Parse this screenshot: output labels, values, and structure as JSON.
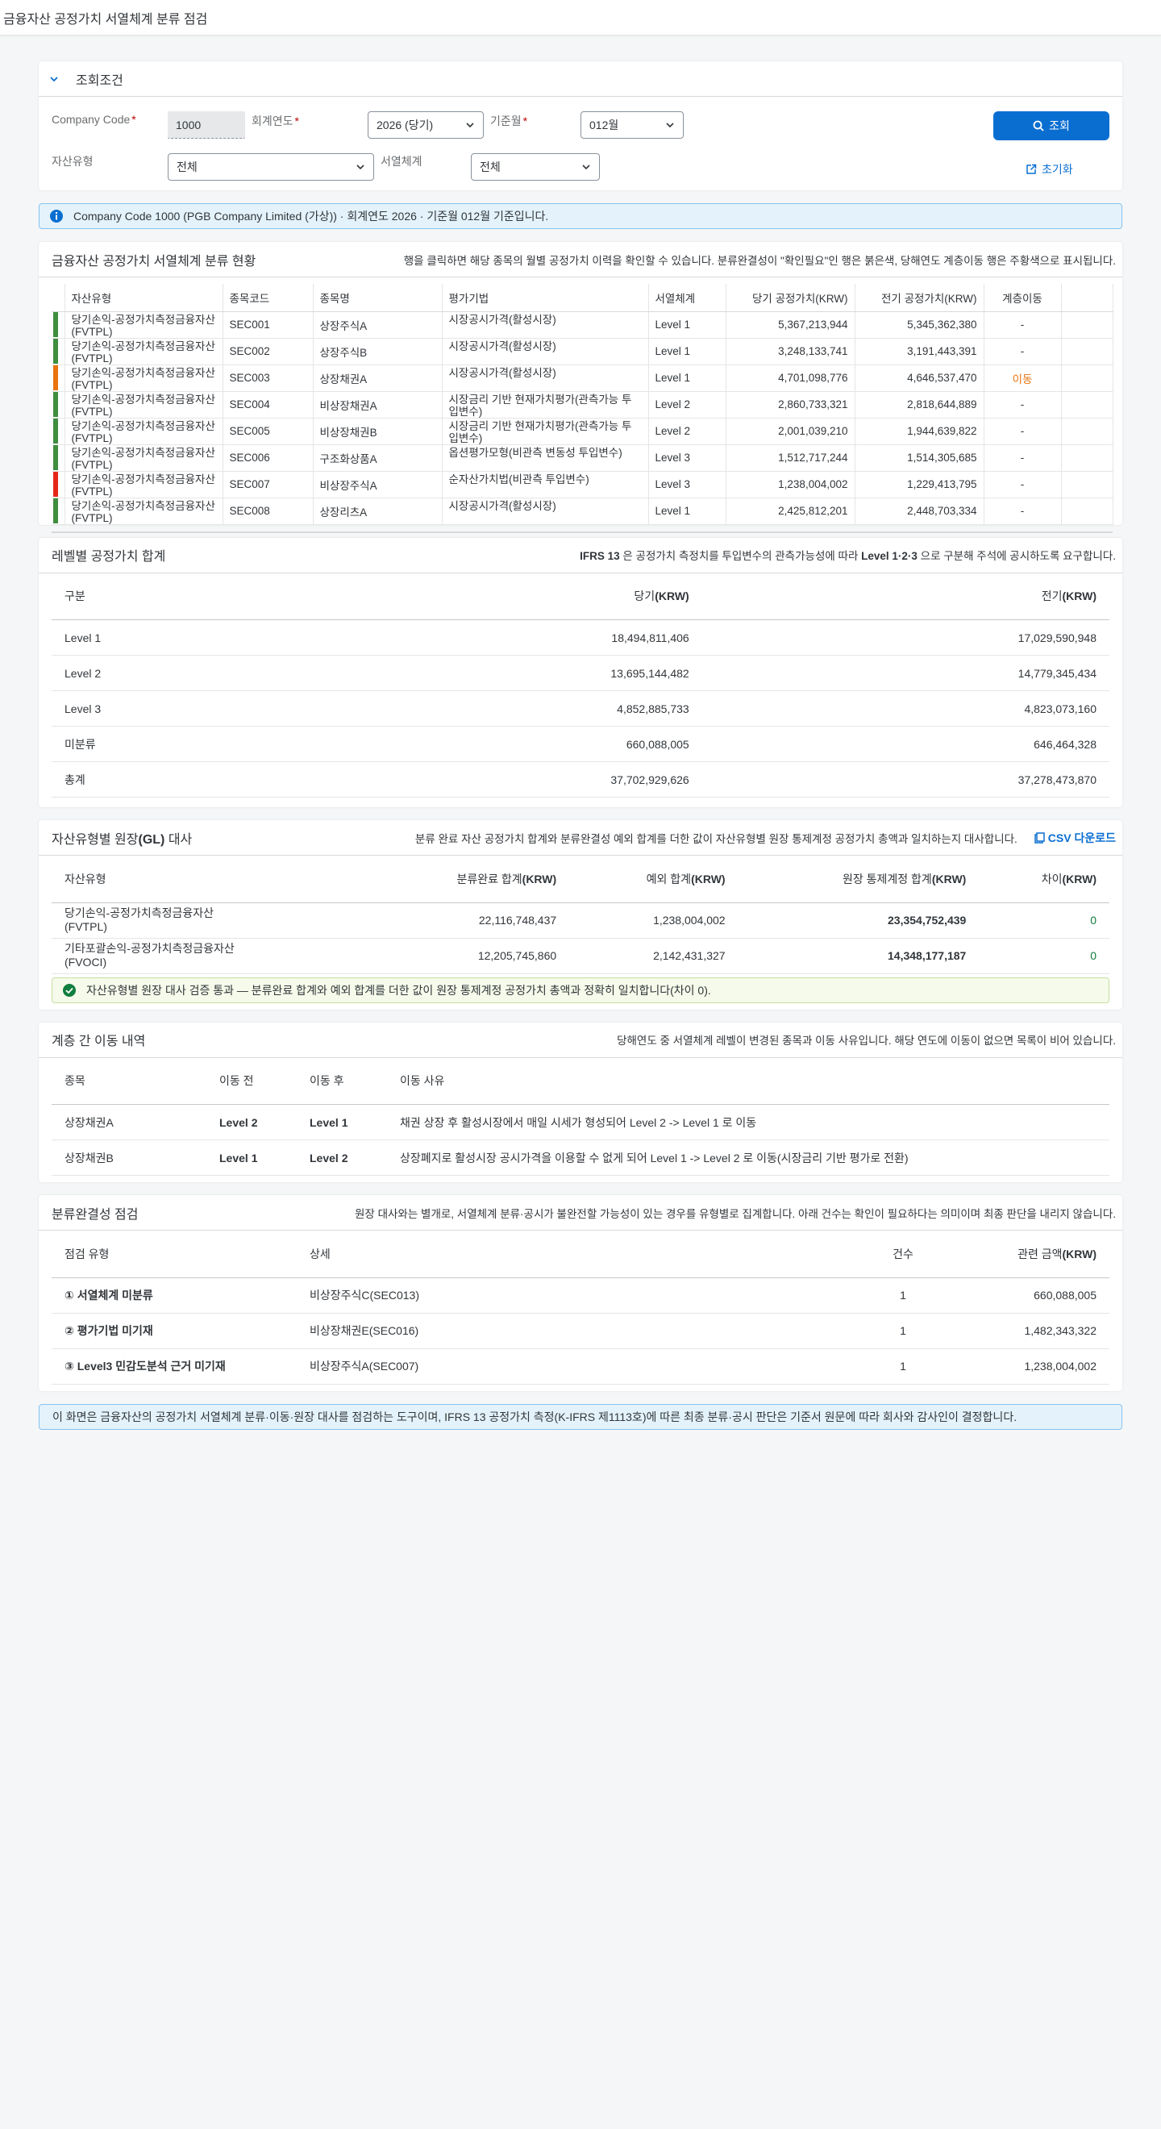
{
  "app": {
    "title": "금융자산 공정가치 서열체계 분류 점검"
  },
  "filter": {
    "title": "조회조건",
    "company_code_label": "Company Code",
    "company_code_value": "1000",
    "fiscal_year_label": "회계연도",
    "fiscal_year_value": "2026 (당기)",
    "period_label": "기준월",
    "period_value": "012월",
    "asset_type_label": "자산유형",
    "asset_type_value": "전체",
    "hierarchy_label": "서열체계",
    "hierarchy_value": "전체",
    "search_button": "조회",
    "reset_button": "초기화"
  },
  "info": {
    "text": "Company Code 1000 (PGB Company Limited (가상)) · 회계연도 2026 · 기준월 012월 기준입니다."
  },
  "classification": {
    "title": "금융자산 공정가치 서열체계 분류 현황",
    "desc": "행을 클릭하면 해당 종목의 월별 공정가치 이력을 확인할 수 있습니다. 분류완결성이 \"확인필요\"인 행은 붉은색, 당해연도 계층이동 행은 주황색으로 표시됩니다.",
    "columns": [
      "자산유형",
      "종목코드",
      "종목명",
      "평가기법",
      "서열체계",
      "당기 공정가치(KRW)",
      "전기 공정가치(KRW)",
      "계층이동"
    ],
    "rows": [
      {
        "status": "green",
        "asset_type": "당기손익-공정가치측정금융자산(FVTPL)",
        "code": "SEC001",
        "name": "상장주식A",
        "method": "시장공시가격(활성시장)",
        "level": "Level 1",
        "current": "5,367,213,944",
        "prior": "5,345,362,380",
        "move": "-"
      },
      {
        "status": "green",
        "asset_type": "당기손익-공정가치측정금융자산(FVTPL)",
        "code": "SEC002",
        "name": "상장주식B",
        "method": "시장공시가격(활성시장)",
        "level": "Level 1",
        "current": "3,248,133,741",
        "prior": "3,191,443,391",
        "move": "-"
      },
      {
        "status": "orange",
        "asset_type": "당기손익-공정가치측정금융자산(FVTPL)",
        "code": "SEC003",
        "name": "상장채권A",
        "method": "시장공시가격(활성시장)",
        "level": "Level 1",
        "current": "4,701,098,776",
        "prior": "4,646,537,470",
        "move": "이동"
      },
      {
        "status": "green",
        "asset_type": "당기손익-공정가치측정금융자산(FVTPL)",
        "code": "SEC004",
        "name": "비상장채권A",
        "method": "시장금리 기반 현재가치평가(관측가능 투입변수)",
        "level": "Level 2",
        "current": "2,860,733,321",
        "prior": "2,818,644,889",
        "move": "-"
      },
      {
        "status": "green",
        "asset_type": "당기손익-공정가치측정금융자산(FVTPL)",
        "code": "SEC005",
        "name": "비상장채권B",
        "method": "시장금리 기반 현재가치평가(관측가능 투입변수)",
        "level": "Level 2",
        "current": "2,001,039,210",
        "prior": "1,944,639,822",
        "move": "-"
      },
      {
        "status": "green",
        "asset_type": "당기손익-공정가치측정금융자산(FVTPL)",
        "code": "SEC006",
        "name": "구조화상품A",
        "method": "옵션평가모형(비관측 변동성 투입변수)",
        "level": "Level 3",
        "current": "1,512,717,244",
        "prior": "1,514,305,685",
        "move": "-"
      },
      {
        "status": "red",
        "asset_type": "당기손익-공정가치측정금융자산(FVTPL)",
        "code": "SEC007",
        "name": "비상장주식A",
        "method": "순자산가치법(비관측 투입변수)",
        "level": "Level 3",
        "current": "1,238,004,002",
        "prior": "1,229,413,795",
        "move": "-"
      },
      {
        "status": "green",
        "asset_type": "당기손익-공정가치측정금융자산(FVTPL)",
        "code": "SEC008",
        "name": "상장리츠A",
        "method": "시장공시가격(활성시장)",
        "level": "Level 1",
        "current": "2,425,812,201",
        "prior": "2,448,703,334",
        "move": "-"
      }
    ]
  },
  "level_totals": {
    "title": "레벨별 공정가치 합계",
    "desc_pre": "",
    "desc_bold1": "IFRS 13",
    "desc_mid": " 은 공정가치 측정치를 투입변수의 관측가능성에 따라 ",
    "desc_bold2": "Level 1·2·3",
    "desc_post": " 으로 구분해 주석에 공시하도록 요구합니다.",
    "col_category": "구분",
    "col_current_pre": "당기",
    "col_current_unit": "(KRW)",
    "col_prior_pre": "전기",
    "col_prior_unit": "(KRW)",
    "rows": [
      {
        "label": "Level 1",
        "current": "18,494,811,406",
        "prior": "17,029,590,948"
      },
      {
        "label": "Level 2",
        "current": "13,695,144,482",
        "prior": "14,779,345,434"
      },
      {
        "label": "Level 3",
        "current": "4,852,885,733",
        "prior": "4,823,073,160"
      },
      {
        "label": "미분류",
        "current": "660,088,005",
        "prior": "646,464,328"
      },
      {
        "label": "총계",
        "current": "37,702,929,626",
        "prior": "37,278,473,870"
      }
    ]
  },
  "gl": {
    "title_pre": "자산유형별 원장",
    "title_bold": "(GL)",
    "title_post": " 대사",
    "desc": "분류 완료 자산 공정가치 합계와 분류완결성 예외 합계를 더한 값이 자산유형별 원장 통제계정 공정가치 총액과 일치하는지 대사합니다.",
    "csv_label": "CSV 다운로드",
    "col_type": "자산유형",
    "col_classified_pre": "분류완료 합계",
    "col_exception_pre": "예외 합계",
    "col_ledger_pre": "원장 통제계정 합계",
    "col_diff_pre": "차이",
    "unit": "(KRW)",
    "rows": [
      {
        "type_l1": "당기손익-공정가치측정금융자산",
        "type_l2": "(FVTPL)",
        "classified": "22,116,748,437",
        "exception": "1,238,004,002",
        "ledger": "23,354,752,439",
        "diff": "0"
      },
      {
        "type_l1": "기타포괄손익-공정가치측정금융자산",
        "type_l2": "(FVOCI)",
        "classified": "12,205,745,860",
        "exception": "2,142,431,327",
        "ledger": "14,348,177,187",
        "diff": "0"
      }
    ],
    "ok_message": "자산유형별 원장 대사 검증 통과 — 분류완료 합계와 예외 합계를 더한 값이 원장 통제계정 공정가치 총액과 정확히 일치합니다(차이 0)."
  },
  "transfers": {
    "title": "계층 간 이동 내역",
    "desc": "당해연도 중 서열체계 레벨이 변경된 종목과 이동 사유입니다. 해당 연도에 이동이 없으면 목록이 비어 있습니다.",
    "columns": [
      "종목",
      "이동 전",
      "이동 후",
      "이동 사유"
    ],
    "rows": [
      {
        "item": "상장채권A",
        "from": "Level 2",
        "to": "Level 1",
        "reason": "채권 상장 후 활성시장에서 매일 시세가 형성되어 Level 2 -> Level 1 로 이동"
      },
      {
        "item": "상장채권B",
        "from": "Level 1",
        "to": "Level 2",
        "reason": "상장폐지로 활성시장 공시가격을 이용할 수 없게 되어 Level 1 -> Level 2 로 이동(시장금리 기반 평가로 전환)"
      }
    ]
  },
  "completeness": {
    "title": "분류완결성 점검",
    "desc": "원장 대사와는 별개로, 서열체계 분류·공시가 불완전할 가능성이 있는 경우를 유형별로 집계합니다. 아래 건수는 확인이 필요하다는 의미이며 최종 판단을 내리지 않습니다.",
    "col_type": "점검 유형",
    "col_detail": "상세",
    "col_count": "건수",
    "col_amount_pre": "관련 금액",
    "col_amount_unit": "(KRW)",
    "rows": [
      {
        "type": "① 서열체계 미분류",
        "detail": "비상장주식C(SEC013)",
        "count": "1",
        "amount": "660,088,005"
      },
      {
        "type": "② 평가기법 미기재",
        "detail": "비상장채권E(SEC016)",
        "count": "1",
        "amount": "1,482,343,322"
      },
      {
        "type": "③ Level3 민감도분석 근거 미기재",
        "detail": "비상장주식A(SEC007)",
        "count": "1",
        "amount": "1,238,004,002"
      }
    ]
  },
  "footer": {
    "text": "이 화면은 금융자산의 공정가치 서열체계 분류·이동·원장 대사를 점검하는 도구이며, IFRS 13 공정가치 측정(K-IFRS 제1113호)에 따른 최종 분류·공시 판단은 기준서 원문에 따라 회사와 감사인이 결정합니다."
  },
  "colors": {
    "accent": "#0a6ed1",
    "ok": "#107e3e",
    "warn": "#e9730c",
    "error": "#e5271a",
    "good_bar": "#3f8d3f"
  }
}
